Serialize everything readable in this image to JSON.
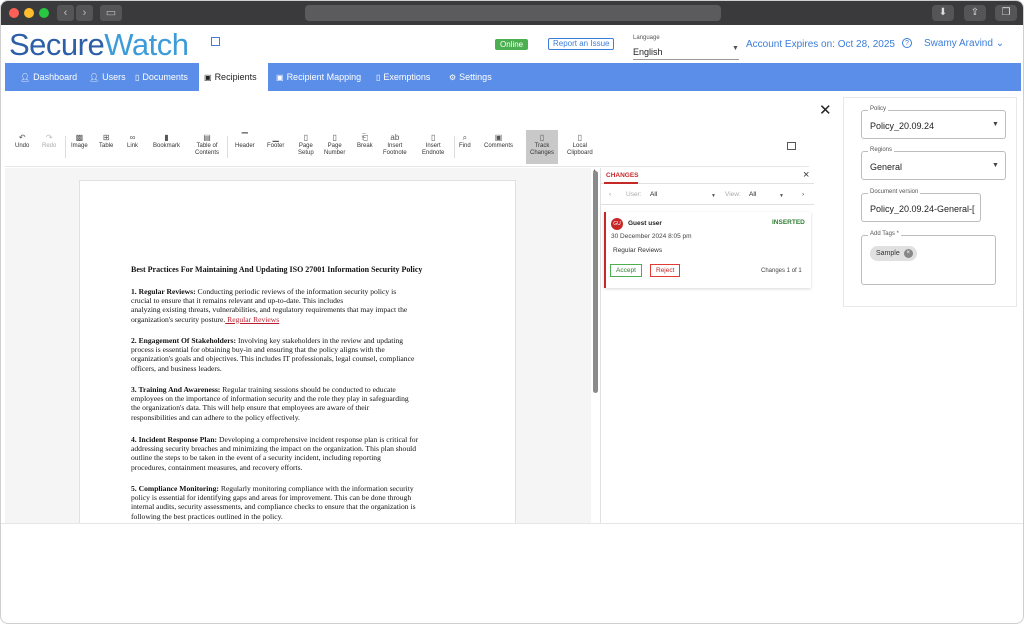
{
  "app": {
    "logo_part1": "Secure",
    "logo_part2": "Watch",
    "status_badge": "Online",
    "report_button": "Report an Issue",
    "language_label": "Language",
    "language_value": "English",
    "account_expires": "Account Expires on: Oct 28, 2025",
    "user_name": "Swamy Aravind",
    "brand_color": "#5b8ee8"
  },
  "nav": {
    "items": [
      {
        "label": "Dashboard",
        "icon": "person-icon"
      },
      {
        "label": "Users",
        "icon": "person-icon"
      },
      {
        "label": "Documents",
        "icon": "document-icon"
      },
      {
        "label": "Recipients",
        "icon": "recipients-icon"
      },
      {
        "label": "Recipient Mapping",
        "icon": "mapping-icon"
      },
      {
        "label": "Exemptions",
        "icon": "document-icon"
      },
      {
        "label": "Settings",
        "icon": "gear-icon"
      }
    ],
    "active": "Recipients"
  },
  "toolbar": {
    "items": [
      {
        "label1": "Undo",
        "label2": "",
        "icon": "undo-icon"
      },
      {
        "label1": "Redo",
        "label2": "",
        "icon": "redo-icon"
      },
      {
        "label1": "Image",
        "label2": "",
        "icon": "image-icon"
      },
      {
        "label1": "Table",
        "label2": "",
        "icon": "table-icon"
      },
      {
        "label1": "Link",
        "label2": "",
        "icon": "link-icon"
      },
      {
        "label1": "Bookmark",
        "label2": "",
        "icon": "bookmark-icon"
      },
      {
        "label1": "Table of",
        "label2": "Contents",
        "icon": "toc-icon"
      },
      {
        "label1": "Header",
        "label2": "",
        "icon": "header-icon"
      },
      {
        "label1": "Footer",
        "label2": "",
        "icon": "footer-icon"
      },
      {
        "label1": "Page",
        "label2": "Setup",
        "icon": "page-setup-icon"
      },
      {
        "label1": "Page",
        "label2": "Number",
        "icon": "page-number-icon"
      },
      {
        "label1": "Break",
        "label2": "",
        "icon": "break-icon"
      },
      {
        "label1": "Insert",
        "label2": "Footnote",
        "icon": "footnote-icon"
      },
      {
        "label1": "Insert",
        "label2": "Endnote",
        "icon": "endnote-icon"
      },
      {
        "label1": "Find",
        "label2": "",
        "icon": "search-icon"
      },
      {
        "label1": "Comments",
        "label2": "",
        "icon": "comment-icon"
      },
      {
        "label1": "Track",
        "label2": "Changes",
        "icon": "track-changes-icon"
      },
      {
        "label1": "Local",
        "label2": "Clipboard",
        "icon": "clipboard-icon"
      }
    ]
  },
  "document": {
    "title": "Best Practices For Maintaining And Updating ISO 27001 Information Security Policy",
    "sections": [
      {
        "heading": "1. Regular Reviews:",
        "lines": [
          "Conducting periodic reviews of the information security policy is",
          "crucial to ensure that it remains relevant and up-to-date. This includes",
          "analyzing existing threats, vulnerabilities, and regulatory requirements that may impact the",
          "organization's security posture."
        ],
        "inserted": " Regular Reviews"
      },
      {
        "heading": "2. Engagement Of Stakeholders:",
        "lines": [
          "Involving key stakeholders in the review and updating",
          "process is essential for obtaining buy-in and ensuring that the policy aligns with the",
          "organization's goals and objectives. This includes IT professionals, legal counsel, compliance",
          "officers, and business leaders."
        ]
      },
      {
        "heading": "3. Training And Awareness:",
        "lines": [
          "Regular training sessions should be conducted to educate",
          "employees on the importance of information security and the role they play in safeguarding",
          "the organization's data. This will help ensure that employees are aware of their",
          "responsibilities and can adhere to the policy effectively."
        ]
      },
      {
        "heading": "4. Incident Response Plan:",
        "lines": [
          "Developing a comprehensive incident response plan is critical for",
          "addressing security breaches and minimizing the impact on the organization. This plan should",
          "outline the steps to be taken in the event of a security incident, including reporting",
          "procedures, containment measures, and recovery efforts."
        ]
      },
      {
        "heading": "5. Compliance Monitoring:",
        "lines": [
          "Regularly monitoring compliance with the information security",
          "policy is essential for identifying gaps and areas for improvement. This can be done through",
          "internal audits, security assessments, and compliance checks to ensure that the organization is",
          "following the best practices outlined in the policy."
        ]
      }
    ]
  },
  "changes": {
    "title": "CHANGES",
    "user_label": "User:",
    "user_value": "All",
    "view_label": "View:",
    "view_value": "All",
    "card": {
      "avatar": "GU",
      "user": "Guest user",
      "status": "INSERTED",
      "date": "30 December 2024 8:05 pm",
      "text": "Regular Reviews",
      "accept": "Accept",
      "reject": "Reject",
      "count": "Changes 1 of 1"
    }
  },
  "meta_panel": {
    "policy_label": "Policy",
    "policy_value": "Policy_20.09.24",
    "regions_label": "Regions",
    "regions_value": "General",
    "version_label": "Document version",
    "version_value": "Policy_20.09.24-General-[",
    "tags_label": "Add Tags *",
    "tag_chip": "Sample"
  }
}
